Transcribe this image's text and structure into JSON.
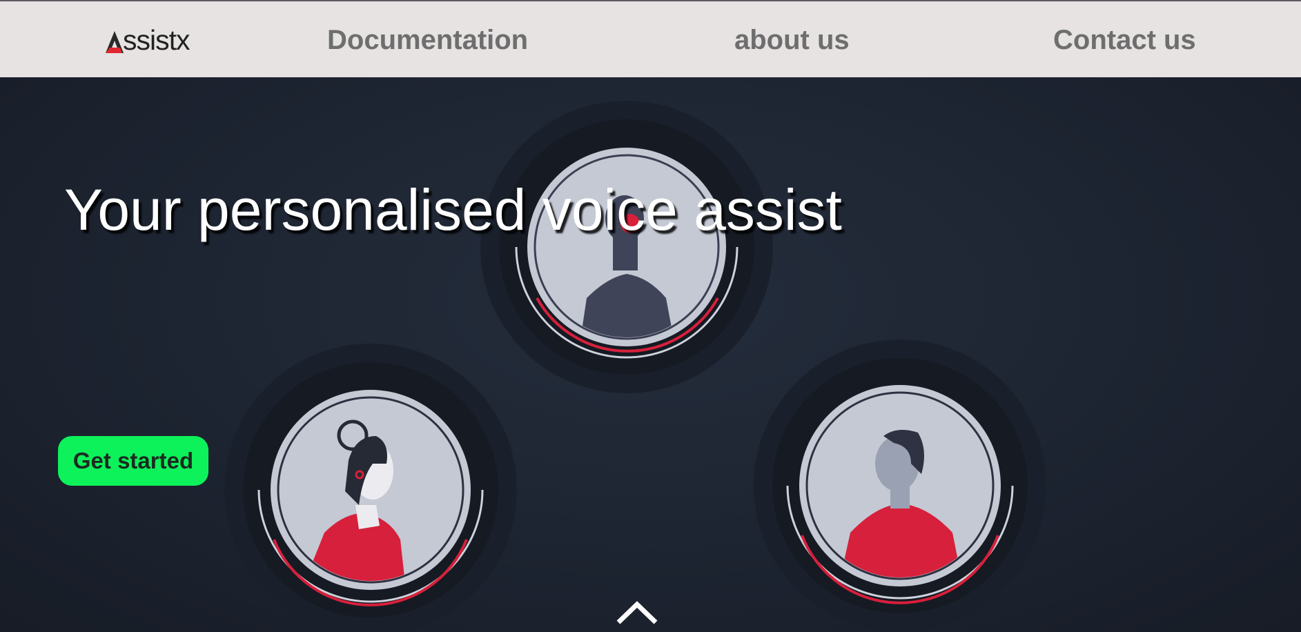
{
  "nav": {
    "logo_text": "ssistx",
    "links": [
      {
        "label": "Documentation"
      },
      {
        "label": "about us"
      },
      {
        "label": "Contact us"
      }
    ]
  },
  "hero": {
    "title": "Your personalised voice assist",
    "cta_label": "Get started",
    "scroll_icon": "chevron-up-icon"
  },
  "colors": {
    "nav_bg": "#e6e3e2",
    "nav_text": "#6e6e6e",
    "hero_bg": "#1c2330",
    "accent_red": "#d7203b",
    "cta_green": "#0df25a",
    "avatar_bg": "#c4c9d4"
  }
}
